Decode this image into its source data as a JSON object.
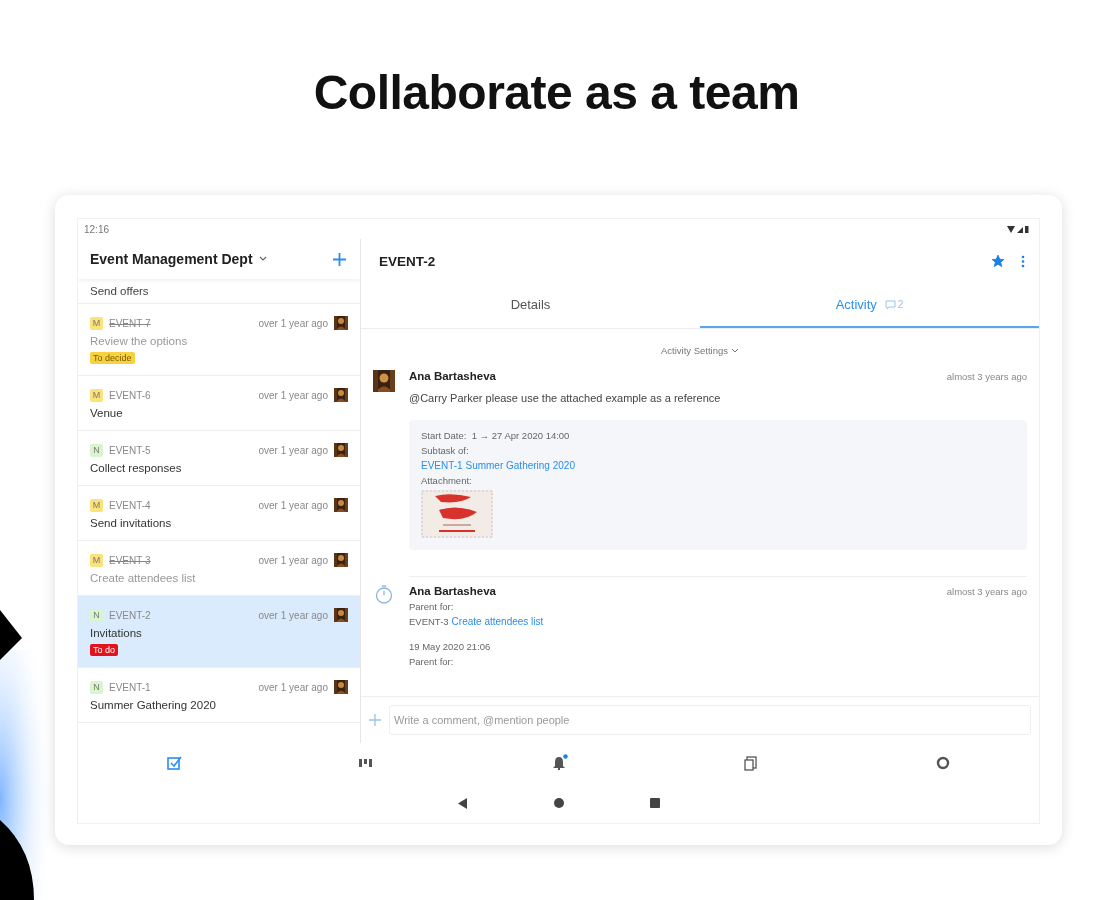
{
  "headline": "Collaborate as a team",
  "status_bar": {
    "time": "12:16"
  },
  "sidebar": {
    "title": "Event Management Dept",
    "cut_item_title": "Send offers",
    "items": [
      {
        "key": "EVENT-7",
        "priority": "M",
        "color": "#fbe27a",
        "time": "over 1 year ago",
        "title": "Review the options",
        "resolved": true,
        "selected": false,
        "tag": {
          "label": "To decide",
          "color": "#f7d23e"
        }
      },
      {
        "key": "EVENT-6",
        "priority": "M",
        "color": "#fbe27a",
        "time": "over 1 year ago",
        "title": "Venue",
        "resolved": false,
        "selected": false
      },
      {
        "key": "EVENT-5",
        "priority": "N",
        "color": "#d9f5cf",
        "time": "over 1 year ago",
        "title": "Collect responses",
        "resolved": false,
        "selected": false
      },
      {
        "key": "EVENT-4",
        "priority": "M",
        "color": "#fbe27a",
        "time": "over 1 year ago",
        "title": "Send invitations",
        "resolved": false,
        "selected": false
      },
      {
        "key": "EVENT-3",
        "priority": "M",
        "color": "#fbe27a",
        "time": "over 1 year ago",
        "title": "Create attendees list",
        "resolved": true,
        "selected": false
      },
      {
        "key": "EVENT-2",
        "priority": "N",
        "color": "#d9f5cf",
        "time": "over 1 year ago",
        "title": "Invitations",
        "resolved": false,
        "selected": true,
        "tag": {
          "label": "To do",
          "color": "#e3131b"
        }
      },
      {
        "key": "EVENT-1",
        "priority": "N",
        "color": "#d9f5cf",
        "time": "over 1 year ago",
        "title": "Summer Gathering 2020",
        "resolved": false,
        "selected": false
      }
    ]
  },
  "detail": {
    "title": "EVENT-2",
    "starred": true,
    "tabs": [
      {
        "label": "Details",
        "selected": false
      },
      {
        "label": "Activity",
        "count": "2",
        "selected": true
      }
    ],
    "activity_settings": "Activity Settings",
    "activity": [
      {
        "kind": "comment",
        "author": "Ana Bartasheva",
        "time": "almost 3 years ago",
        "text": "@Carry Parker please use the attached example as a reference",
        "details": {
          "start_label": "Start Date:",
          "start_value": "1 → 27 Apr 2020 14:00",
          "subtask_label": "Subtask of:",
          "subtask_link": "EVENT-1 Summer Gathering 2020",
          "attachment_label": "Attachment:"
        }
      },
      {
        "kind": "change",
        "author": "Ana Bartasheva",
        "time": "almost 3 years ago",
        "lines": [
          {
            "kind": "label",
            "text": "Parent for:"
          },
          {
            "kind": "link",
            "prefix": "EVENT-3",
            "link": "Create attendees list"
          },
          {
            "kind": "date",
            "text": "19 May 2020 21:06"
          },
          {
            "kind": "label",
            "text": "Parent for:"
          }
        ]
      }
    ],
    "comment_field": {
      "placeholder": "Write a comment, @mention people"
    }
  },
  "bottom_nav": [
    {
      "kind": "check",
      "selected": true,
      "notification": false
    },
    {
      "kind": "board",
      "selected": false,
      "notification": false
    },
    {
      "kind": "bell",
      "selected": false,
      "notification": true
    },
    {
      "kind": "pages",
      "selected": false,
      "notification": false
    },
    {
      "kind": "gear",
      "selected": false,
      "notification": false
    }
  ]
}
